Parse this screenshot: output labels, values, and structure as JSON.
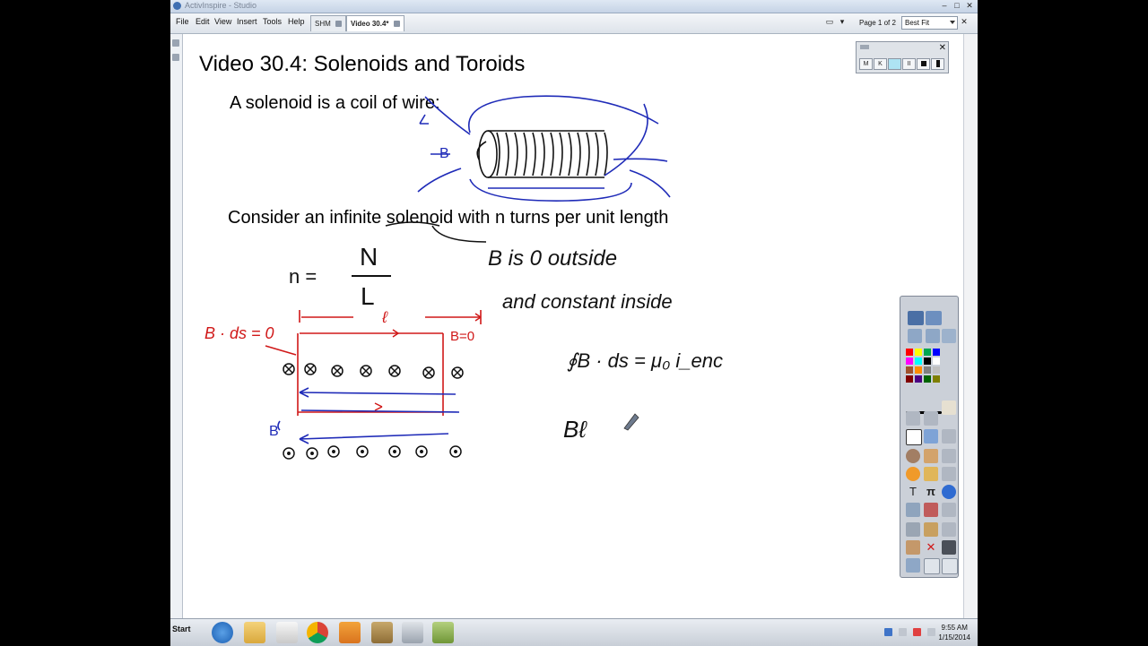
{
  "window": {
    "title": "ActivInspire - Studio"
  },
  "menu": {
    "items": [
      "File",
      "Edit",
      "View",
      "Insert",
      "Tools",
      "Help"
    ]
  },
  "tabs": [
    {
      "label": "SHM"
    },
    {
      "label": "Video 30.4*"
    }
  ],
  "page_indicator": "Page 1 of 2",
  "zoom": "Best Fit",
  "slide": {
    "title": "Video 30.4: Solenoids and Toroids",
    "line1": "A solenoid is a coil of wire:",
    "line2": "Consider an infinite solenoid with n turns per unit length"
  },
  "handwriting": {
    "n_eq": "n =",
    "numerator": "N",
    "denominator": "L",
    "b_outside": "B is 0 outside",
    "const_inside": "and constant inside",
    "ampere": "∮B · ds = μ₀ i_enc",
    "bdotds_zero": "B · ds = 0",
    "ell": "ℓ",
    "b_eq_zero": "B=0",
    "b_label_top": "B",
    "b_label_bottom": "B",
    "b_ell": "Bℓ"
  },
  "recorder": {
    "buttons": [
      "M",
      "K",
      "",
      "II",
      "",
      ""
    ]
  },
  "toolbox": {
    "colors": [
      "#ff0000",
      "#ffff00",
      "#00a651",
      "#0000ff",
      "#ff00ff",
      "#00ffff",
      "#000000",
      "#ffffff",
      "#a0522d",
      "#ff8c00",
      "#808080",
      "#c0c0c0",
      "#800000",
      "#4b0082",
      "#006400",
      "#7f7f00"
    ],
    "text_tool": "T",
    "pi_tool": "π"
  },
  "taskbar": {
    "start": "Start",
    "time": "9:55 AM",
    "date": "1/15/2014"
  },
  "colors": {
    "ink_black": "#111111",
    "ink_blue": "#1f2bb8",
    "ink_red": "#d01818"
  }
}
